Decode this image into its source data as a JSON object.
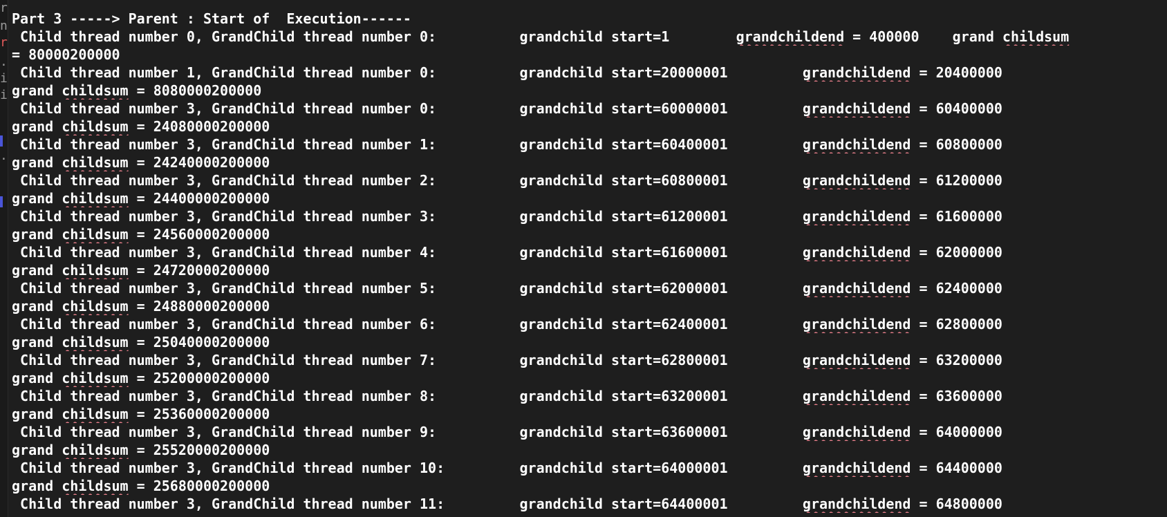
{
  "terminal": {
    "lines": [
      [
        {
          "t": "Part 3 -----> Parent : Start of  Execution------"
        }
      ],
      [
        {
          "t": " Child thread number 0, GrandChild thread number 0:          grandchild start=1        "
        },
        {
          "t": "grandchildend",
          "s": true
        },
        {
          "t": " = 400000    grand "
        },
        {
          "t": "childsum",
          "s": true
        }
      ],
      [
        {
          "t": "= 80000200000"
        }
      ],
      [
        {
          "t": " Child thread number 1, GrandChild thread number 0:          grandchild start=20000001         "
        },
        {
          "t": "grandchildend",
          "s": true
        },
        {
          "t": " = 20400000"
        }
      ],
      [
        {
          "t": "grand "
        },
        {
          "t": "childsum",
          "s": true
        },
        {
          "t": " = 8080000200000"
        }
      ],
      [
        {
          "t": " Child thread number 3, GrandChild thread number 0:          grandchild start=60000001         "
        },
        {
          "t": "grandchildend",
          "s": true
        },
        {
          "t": " = 60400000"
        }
      ],
      [
        {
          "t": "grand "
        },
        {
          "t": "childsum",
          "s": true
        },
        {
          "t": " = 24080000200000"
        }
      ],
      [
        {
          "t": " Child thread number 3, GrandChild thread number 1:          grandchild start=60400001         "
        },
        {
          "t": "grandchildend",
          "s": true
        },
        {
          "t": " = 60800000"
        }
      ],
      [
        {
          "t": "grand "
        },
        {
          "t": "childsum",
          "s": true
        },
        {
          "t": " = 24240000200000"
        }
      ],
      [
        {
          "t": " Child thread number 3, GrandChild thread number 2:          grandchild start=60800001         "
        },
        {
          "t": "grandchildend",
          "s": true
        },
        {
          "t": " = 61200000"
        }
      ],
      [
        {
          "t": "grand "
        },
        {
          "t": "childsum",
          "s": true
        },
        {
          "t": " = 24400000200000"
        }
      ],
      [
        {
          "t": " Child thread number 3, GrandChild thread number 3:          grandchild start=61200001         "
        },
        {
          "t": "grandchildend",
          "s": true
        },
        {
          "t": " = 61600000"
        }
      ],
      [
        {
          "t": "grand "
        },
        {
          "t": "childsum",
          "s": true
        },
        {
          "t": " = 24560000200000"
        }
      ],
      [
        {
          "t": " Child thread number 3, GrandChild thread number 4:          grandchild start=61600001         "
        },
        {
          "t": "grandchildend",
          "s": true
        },
        {
          "t": " = 62000000"
        }
      ],
      [
        {
          "t": "grand "
        },
        {
          "t": "childsum",
          "s": true
        },
        {
          "t": " = 24720000200000"
        }
      ],
      [
        {
          "t": " Child thread number 3, GrandChild thread number 5:          grandchild start=62000001         "
        },
        {
          "t": "grandchildend",
          "s": true
        },
        {
          "t": " = 62400000"
        }
      ],
      [
        {
          "t": "grand "
        },
        {
          "t": "childsum",
          "s": true
        },
        {
          "t": " = 24880000200000"
        }
      ],
      [
        {
          "t": " Child thread number 3, GrandChild thread number 6:          grandchild start=62400001         "
        },
        {
          "t": "grandchildend",
          "s": true
        },
        {
          "t": " = 62800000"
        }
      ],
      [
        {
          "t": "grand "
        },
        {
          "t": "childsum",
          "s": true
        },
        {
          "t": " = 25040000200000"
        }
      ],
      [
        {
          "t": " Child thread number 3, GrandChild thread number 7:          grandchild start=62800001         "
        },
        {
          "t": "grandchildend",
          "s": true
        },
        {
          "t": " = 63200000"
        }
      ],
      [
        {
          "t": "grand "
        },
        {
          "t": "childsum",
          "s": true
        },
        {
          "t": " = 25200000200000"
        }
      ],
      [
        {
          "t": " Child thread number 3, GrandChild thread number 8:          grandchild start=63200001         "
        },
        {
          "t": "grandchildend",
          "s": true
        },
        {
          "t": " = 63600000"
        }
      ],
      [
        {
          "t": "grand "
        },
        {
          "t": "childsum",
          "s": true
        },
        {
          "t": " = 25360000200000"
        }
      ],
      [
        {
          "t": " Child thread number 3, GrandChild thread number 9:          grandchild start=63600001         "
        },
        {
          "t": "grandchildend",
          "s": true
        },
        {
          "t": " = 64000000"
        }
      ],
      [
        {
          "t": "grand "
        },
        {
          "t": "childsum",
          "s": true
        },
        {
          "t": " = 25520000200000"
        }
      ],
      [
        {
          "t": " Child thread number 3, GrandChild thread number 10:         grandchild start=64000001         "
        },
        {
          "t": "grandchildend",
          "s": true
        },
        {
          "t": " = 64400000"
        }
      ],
      [
        {
          "t": "grand "
        },
        {
          "t": "childsum",
          "s": true
        },
        {
          "t": " = 25680000200000"
        }
      ],
      [
        {
          "t": " Child thread number 3, GrandChild thread number 11:         grandchild start=64400001         "
        },
        {
          "t": "grandchildend",
          "s": true
        },
        {
          "t": " = 64800000"
        }
      ]
    ]
  },
  "gutter": {
    "glyphs": [
      "r",
      "n",
      "r",
      ".",
      "i",
      "i",
      "d",
      "d"
    ],
    "mark_color": "#4a55d8"
  },
  "colors": {
    "background": "#1e1e1e",
    "text": "#ffffff",
    "squiggle": "#e07b86"
  }
}
